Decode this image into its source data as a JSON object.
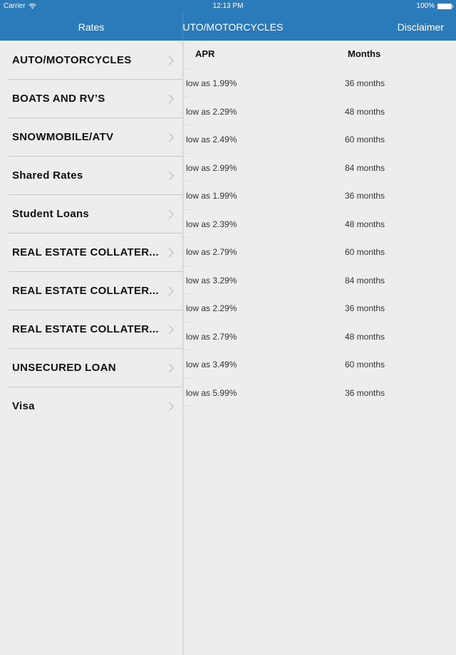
{
  "status_bar": {
    "carrier": "Carrier",
    "time": "12:13 PM",
    "battery": "100%"
  },
  "nav": {
    "master_title": "Rates",
    "detail_title": "AUTO/MOTORCYCLES",
    "disclaimer_label": "Disclaimer"
  },
  "master": {
    "items": [
      {
        "label": "AUTO/MOTORCYCLES"
      },
      {
        "label": "BOATS AND RV’S"
      },
      {
        "label": "SNOWMOBILE/ATV"
      },
      {
        "label": "Shared Rates"
      },
      {
        "label": "Student Loans"
      },
      {
        "label": "REAL ESTATE COLLATER..."
      },
      {
        "label": "REAL ESTATE COLLATER..."
      },
      {
        "label": "REAL ESTATE COLLATER..."
      },
      {
        "label": "UNSECURED LOAN"
      },
      {
        "label": "Visa"
      }
    ]
  },
  "detail": {
    "columns": {
      "apr": "APR",
      "months": "Months"
    },
    "rows": [
      {
        "apr": "low as 1.99%",
        "months": "36 months"
      },
      {
        "apr": "low as 2.29%",
        "months": "48 months"
      },
      {
        "apr": "low as 2.49%",
        "months": "60 months"
      },
      {
        "apr": "low as 2.99%",
        "months": "84 months"
      },
      {
        "apr": "low as 1.99%",
        "months": "36 months"
      },
      {
        "apr": "low as 2.39%",
        "months": "48 months"
      },
      {
        "apr": "low as 2.79%",
        "months": "60 months"
      },
      {
        "apr": "low as 3.29%",
        "months": "84 months"
      },
      {
        "apr": "low as 2.29%",
        "months": "36 months"
      },
      {
        "apr": "low as 2.79%",
        "months": "48 months"
      },
      {
        "apr": "low as 3.49%",
        "months": "60 months"
      },
      {
        "apr": "low as 5.99%",
        "months": "36 months"
      }
    ]
  },
  "colors": {
    "nav_bar": "#2a7bba",
    "background": "#ededed",
    "separator": "#c3c7d6"
  }
}
